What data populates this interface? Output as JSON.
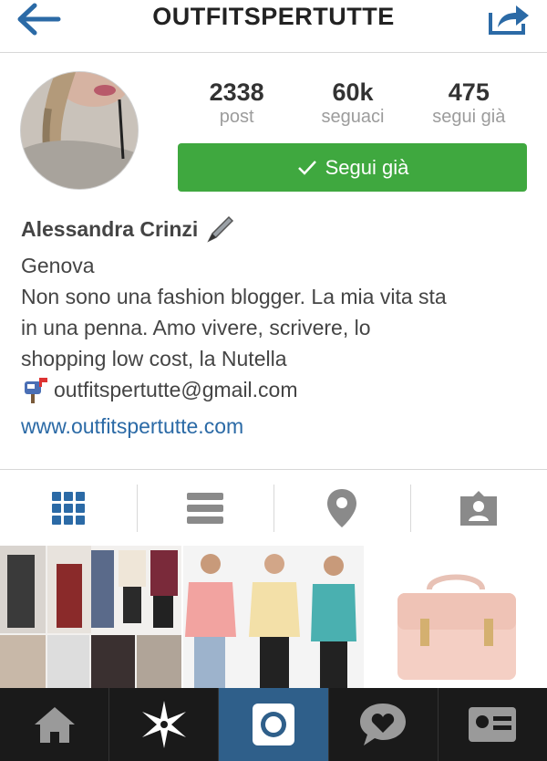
{
  "header": {
    "title": "OUTFITSPERTUTTE"
  },
  "stats": [
    {
      "value": "2338",
      "label": "post"
    },
    {
      "value": "60k",
      "label": "seguaci"
    },
    {
      "value": "475",
      "label": "segui già"
    }
  ],
  "follow_button": {
    "label": "Segui già"
  },
  "profile": {
    "name": "Alessandra Crinzi",
    "city": "Genova",
    "bio_lines": [
      "Non sono una fashion blogger. La mia vita sta",
      "in una penna. Amo vivere, scrivere, lo",
      "shopping low cost, la Nutella"
    ],
    "email": "outfitspertutte@gmail.com",
    "website": "www.outfitspertutte.com"
  },
  "tabs": [
    "grid-icon",
    "list-icon",
    "location-pin-icon",
    "tagged-person-icon"
  ],
  "bottom_nav": [
    "home-icon",
    "explore-icon",
    "camera-icon",
    "activity-icon",
    "profile-icon"
  ],
  "colors": {
    "accent": "#3fa83f",
    "link": "#2b6aa6",
    "tab_icon_active": "#2b6aa6",
    "nav_active": "#2f5f8a"
  }
}
